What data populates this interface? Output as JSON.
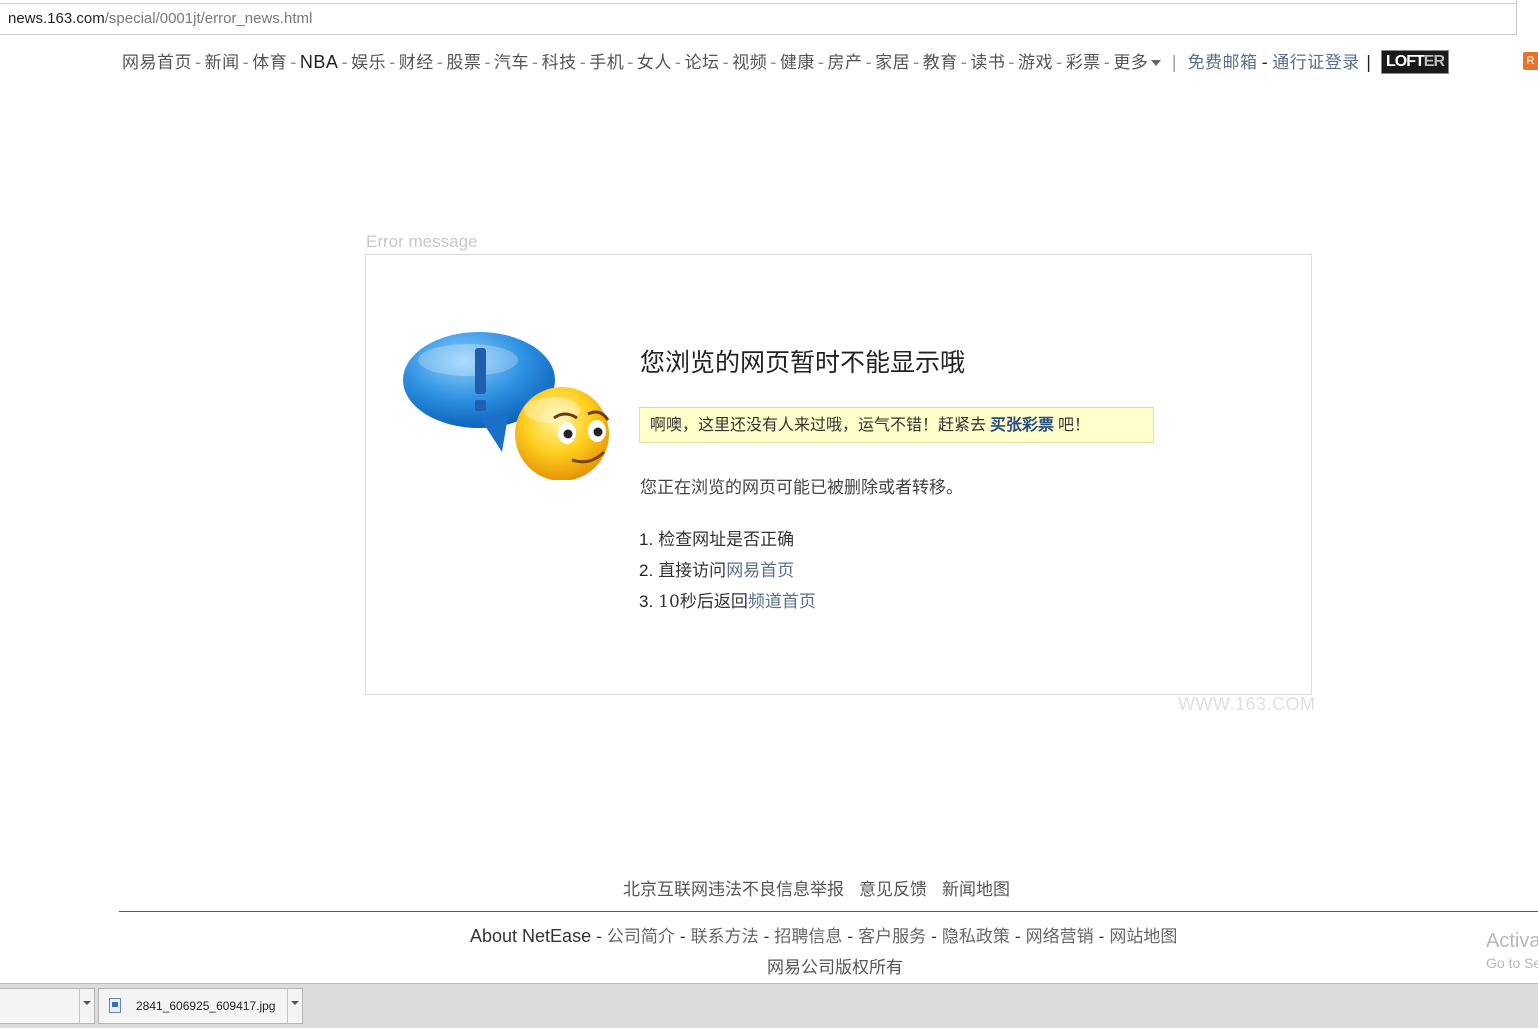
{
  "browser": {
    "url_host": "news.163.com",
    "url_path": "/special/0001jt/error_news.html"
  },
  "topnav": {
    "items": [
      "网易首页",
      "新闻",
      "体育",
      "NBA",
      "娱乐",
      "财经",
      "股票",
      "汽车",
      "科技",
      "手机",
      "女人",
      "论坛",
      "视频",
      "健康",
      "房产",
      "家居",
      "教育",
      "读书",
      "游戏",
      "彩票"
    ],
    "more_label": "更多",
    "mail_label": "免费邮箱",
    "login_label": "通行证登录",
    "lofter_a": "LOFT",
    "lofter_b": "ER",
    "rss_label": "R"
  },
  "error": {
    "label": "Error message",
    "headline": "您浏览的网页暂时不能显示哦",
    "notice_prefix": "啊噢，这里还没有人来过哦，运气不错！赶紧去",
    "notice_link": "买张彩票",
    "notice_suffix": "吧！",
    "description": "您正在浏览的网页可能已被删除或者转移。",
    "steps": [
      {
        "num": "1.",
        "text": "检查网址是否正确",
        "link": ""
      },
      {
        "num": "2.",
        "text": "直接访问",
        "link": "网易首页"
      },
      {
        "num": "3.",
        "text": "10秒后返回",
        "link": "频道首页"
      }
    ],
    "watermark": "WWW.163.COM"
  },
  "footer": {
    "links": [
      "北京互联网违法不良信息举报",
      "意见反馈",
      "新闻地图"
    ],
    "about": "About NetEase",
    "nav": [
      "公司简介",
      "联系方法",
      "招聘信息",
      "客户服务",
      "隐私政策",
      "网络营销",
      "网站地图"
    ],
    "copyright": "网易公司版权所有",
    "activate_line1": "Activa",
    "activate_line2": "Go to Se"
  },
  "downloads": {
    "items": [
      {
        "name": ""
      },
      {
        "name": "2841_606925_609417.jpg"
      }
    ]
  },
  "colors": {
    "link_blue": "#5a6f8e",
    "notice_bg": "#ffffcc",
    "lottery_link": "#2b4a80"
  },
  "icons": [
    "exclamation-bubble-icon",
    "smiley-face-icon",
    "caret-down-icon",
    "image-file-icon",
    "rss-icon"
  ]
}
